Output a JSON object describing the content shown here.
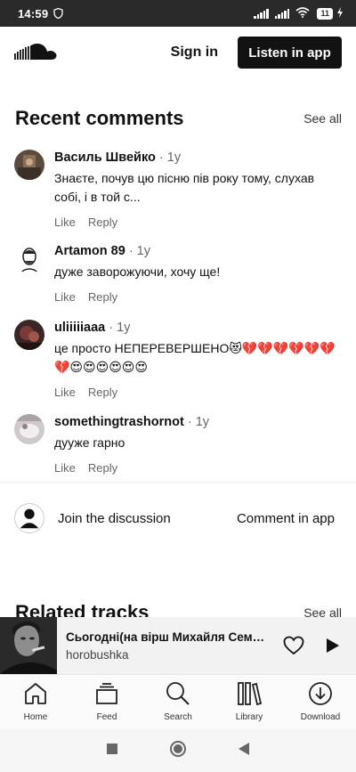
{
  "status_bar": {
    "time": "14:59",
    "battery": "11"
  },
  "header": {
    "signin_label": "Sign in",
    "listen_label": "Listen in app"
  },
  "comments_section": {
    "title": "Recent comments",
    "see_all": "See all",
    "comments": [
      {
        "author": "Василь Швейко",
        "ago": "1y",
        "text": "Знаєте, почув цю пісню пів року тому, слухав собі, і в той с...",
        "like": "Like",
        "reply": "Reply"
      },
      {
        "author": "Artamon 89",
        "ago": "1y",
        "text": "дуже заворожуючи, хочу ще!",
        "like": "Like",
        "reply": "Reply"
      },
      {
        "author": "uliiiiiaaa",
        "ago": "1y",
        "text": "це просто НЕПЕРЕВЕРШЕНО😻💔💔💔💔💔💔💔😍😍😍😍😍😍",
        "like": "Like",
        "reply": "Reply"
      },
      {
        "author": "somethingtrashornot",
        "ago": "1y",
        "text": "дууже гарно",
        "like": "Like",
        "reply": "Reply"
      }
    ]
  },
  "join": {
    "label": "Join the discussion",
    "comment_in_app": "Comment in app"
  },
  "related": {
    "title": "Related tracks",
    "see_all": "See all"
  },
  "player": {
    "track": "Сьогодні(на вірш Михайля Семен…",
    "artist": "horobushka"
  },
  "tabs": [
    {
      "label": "Home",
      "icon": "home-icon"
    },
    {
      "label": "Feed",
      "icon": "feed-icon"
    },
    {
      "label": "Search",
      "icon": "search-icon"
    },
    {
      "label": "Library",
      "icon": "library-icon"
    },
    {
      "label": "Download",
      "icon": "download-icon"
    }
  ],
  "colors": {
    "status_bar": "#2a2a2a",
    "button_dark": "#121212",
    "player_bg": "#f2f2f2"
  }
}
